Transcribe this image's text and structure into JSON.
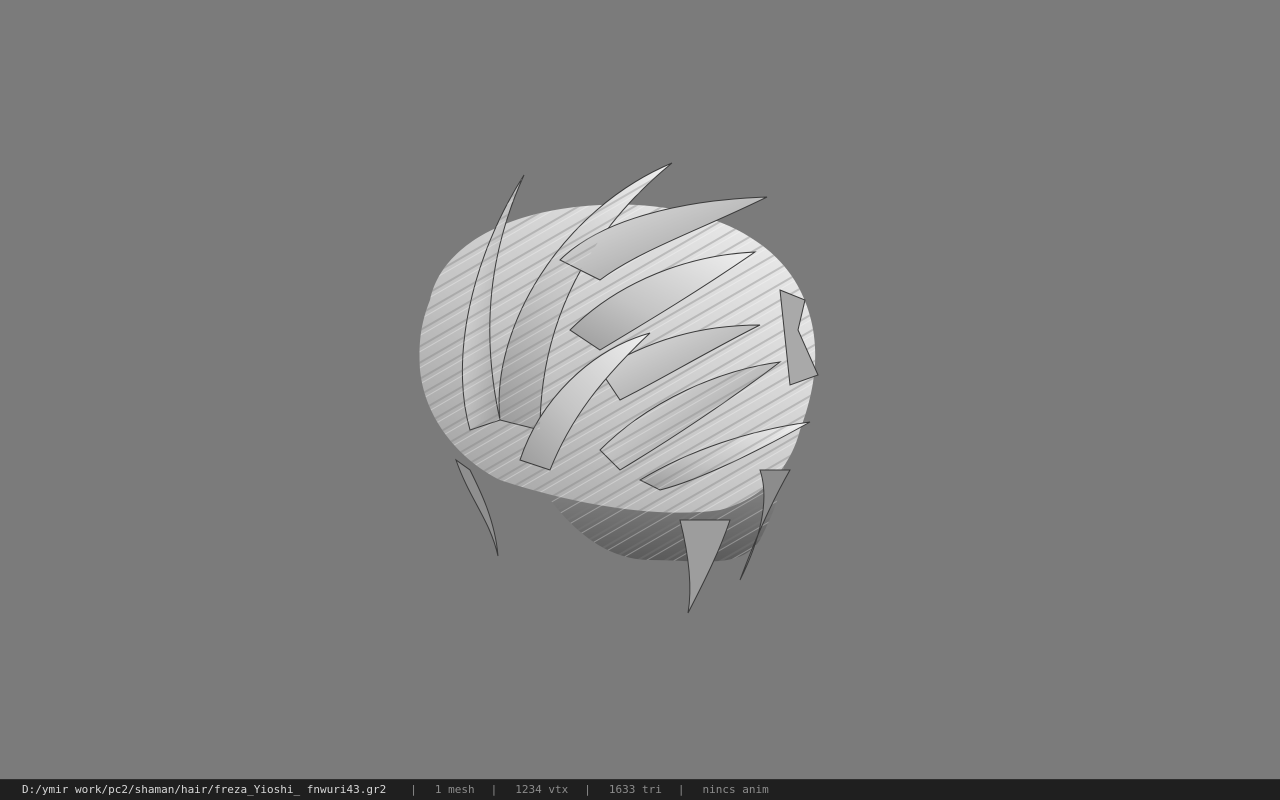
{
  "viewer": {
    "background_color": "#7b7b7b",
    "model_name": "hair mesh"
  },
  "status_bar": {
    "file_path": "D:/ymir work/pc2/shaman/hair/freza_Yioshi_ fnwuri43.gr2",
    "separator": "|",
    "mesh_count": "1 mesh",
    "vertex_count": "1234 vtx",
    "triangle_count": "1633 tri",
    "anim_status": "nincs anim"
  }
}
